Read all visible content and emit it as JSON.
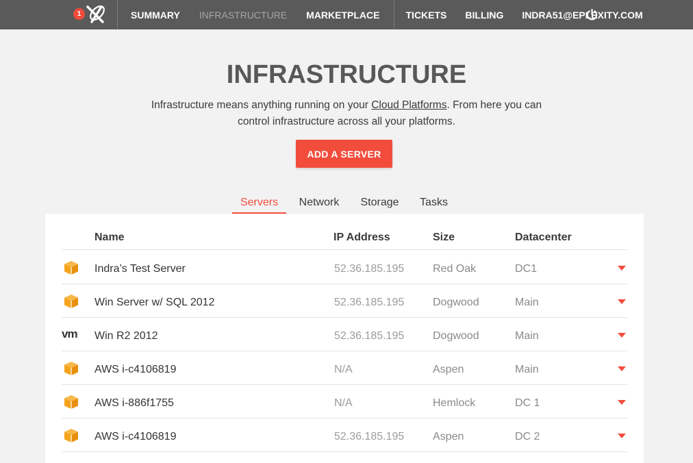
{
  "nav": {
    "badge_count": "1",
    "items": [
      {
        "label": "SUMMARY",
        "active": false
      },
      {
        "label": "INFRASTRUCTURE",
        "active": true
      },
      {
        "label": "MARKETPLACE",
        "active": false
      },
      {
        "label": "TICKETS",
        "active": false
      },
      {
        "label": "BILLING",
        "active": false
      },
      {
        "label": "INDRA51@EPLEXITY.COM",
        "active": false
      }
    ],
    "logout_icon": "power-icon"
  },
  "header": {
    "title": "INFRASTRUCTURE",
    "intro_before": "Infrastructure means anything running on your ",
    "intro_link": "Cloud Platforms",
    "intro_after": ". From here you can control infrastructure across all your platforms.",
    "add_button": "ADD A SERVER"
  },
  "tabs": [
    {
      "label": "Servers",
      "active": true
    },
    {
      "label": "Network",
      "active": false
    },
    {
      "label": "Storage",
      "active": false
    },
    {
      "label": "Tasks",
      "active": false
    }
  ],
  "table": {
    "columns": [
      "Name",
      "IP Address",
      "Size",
      "Datacenter"
    ],
    "rows": [
      {
        "icon": "aws-box-icon",
        "name": "Indra’s Test Server",
        "ip": "52.36.185.195",
        "size": "Red Oak",
        "datacenter": "DC1"
      },
      {
        "icon": "aws-box-icon",
        "name": "Win Server w/ SQL 2012",
        "ip": "52.36.185.195",
        "size": "Dogwood",
        "datacenter": "Main"
      },
      {
        "icon": "vmware-icon",
        "name": "Win R2 2012",
        "ip": "52.36.185.195",
        "size": "Dogwood",
        "datacenter": "Main"
      },
      {
        "icon": "aws-box-icon",
        "name": "AWS i-c4106819",
        "ip": "N/A",
        "size": "Aspen",
        "datacenter": "Main"
      },
      {
        "icon": "aws-box-icon",
        "name": "AWS i-886f1755",
        "ip": "N/A",
        "size": "Hemlock",
        "datacenter": "DC 1"
      },
      {
        "icon": "aws-box-icon",
        "name": "AWS i-c4106819",
        "ip": "52.36.185.195",
        "size": "Aspen",
        "datacenter": "DC 2"
      }
    ],
    "vm_text": "vm"
  },
  "colors": {
    "accent": "#f24d3c",
    "nav_bg": "#5a5a5a",
    "aws_orange": "#f5a31b"
  }
}
